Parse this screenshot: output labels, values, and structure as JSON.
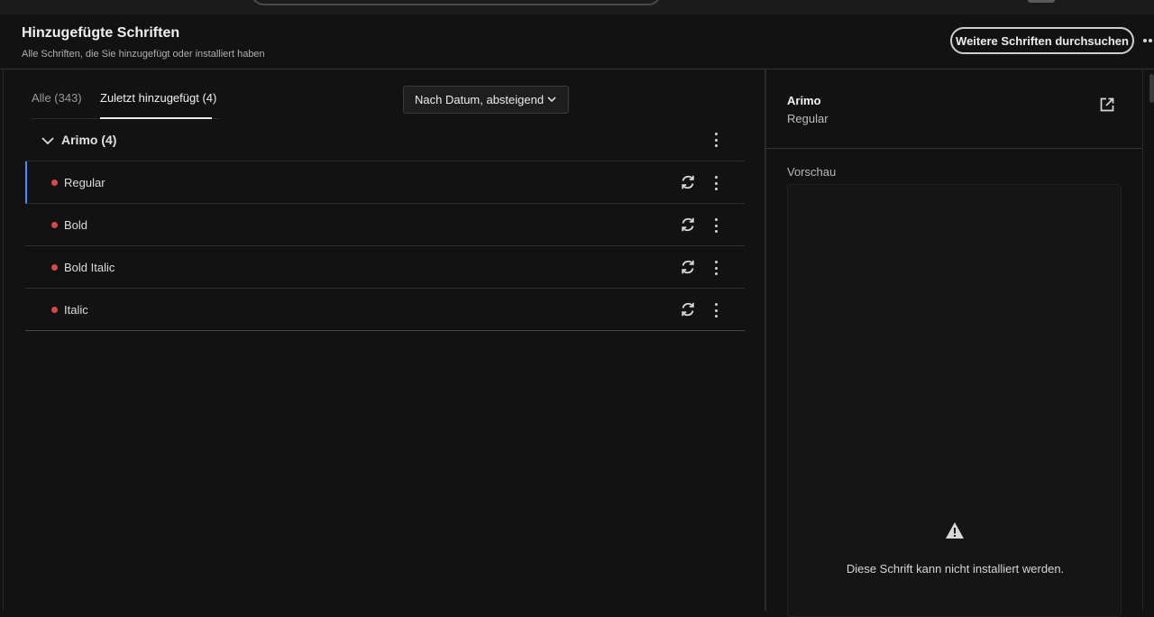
{
  "header": {
    "title": "Hinzugefügte Schriften",
    "subtitle": "Alle Schriften, die Sie hinzugefügt oder installiert haben",
    "browse_button": "Weitere Schriften durchsuchen"
  },
  "tabs": [
    {
      "label": "Alle (343)",
      "active": false
    },
    {
      "label": "Zuletzt hinzugefügt (4)",
      "active": true
    }
  ],
  "sort": {
    "selected": "Nach Datum, absteigend"
  },
  "family": {
    "name": "Arimo (4)",
    "expanded": true
  },
  "styles": [
    {
      "label": "Regular",
      "selected": true
    },
    {
      "label": "Bold",
      "selected": false
    },
    {
      "label": "Bold Italic",
      "selected": false
    },
    {
      "label": "Italic",
      "selected": false
    }
  ],
  "detail": {
    "family": "Arimo",
    "style": "Regular",
    "preview_label": "Vorschau",
    "warning_text": "Diese Schrift kann nicht installiert werden."
  },
  "colors": {
    "background": "#121212",
    "selected_accent": "#4b8ff5",
    "status_dot": "#d94848"
  },
  "icons": [
    "chevron-down-icon",
    "sync-icon",
    "more-vertical-icon",
    "more-horizontal-icon",
    "open-external-icon",
    "warning-icon"
  ]
}
